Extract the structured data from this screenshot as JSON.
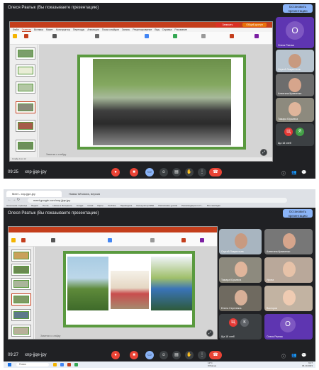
{
  "shot1": {
    "meet_title": "Олеся Рватык (Вы показываете презентацию)",
    "present_button": "Остановить презентацию",
    "time": "09:25",
    "meeting_code": "xnp-jjqe-jpy",
    "ppt_tabs": [
      "Файл",
      "Главная",
      "Вставка",
      "Макет",
      "Конструктор",
      "Переходы",
      "Анимация",
      "Показ слайдов",
      "Запись",
      "Рецензирование",
      "Вид",
      "Справка",
      "Рисование"
    ],
    "record_label": "Записать",
    "share_label": "Общий доступ",
    "notes_label": "Заметки к слайду",
    "status_text": "Слайд 4 из 12",
    "participants": [
      {
        "name": "Олеся Рватык",
        "initial": "О",
        "color": "#7e57c2"
      },
      {
        "name": "Сергей Лаврентьев"
      },
      {
        "name": "Алевтина Кравченко"
      },
      {
        "name": "Тамара Юрьевна"
      },
      {
        "name": "Ща 18 хлеб",
        "initials": [
          "Щ",
          "Я"
        ]
      }
    ]
  },
  "shot2": {
    "tabs": [
      {
        "label": "Meet - xnp-jjqe-jpy"
      },
      {
        "label": "Новая Windows, версия"
      }
    ],
    "url": "meet.google.com/xnp-jjqe-jpy",
    "bookmarks": [
      "Начальная страница",
      "Яндекс",
      "Почта",
      "Новые в Интернете",
      "Google",
      "Gmail",
      "Карты",
      "YouTube",
      "Переводчик",
      "Калькулятор ВАШ",
      "Расписание уроков",
      "Рекомендации по П...",
      "Все закладки"
    ],
    "meet_title": "Олеся Рватык (Вы показываете презентацию)",
    "present_button": "Остановить презентацию",
    "time": "09:27",
    "meeting_code": "xnp-jjqe-jpy",
    "notes_label": "Заметки к слайду",
    "participants": [
      {
        "name": "Сергей Лаврентьев"
      },
      {
        "name": "Алевтина Кравченко"
      },
      {
        "name": "Тамара Юрьевна"
      },
      {
        "name": "Ирина"
      },
      {
        "name": "Елена Сергеевна"
      },
      {
        "name": "Виктория"
      },
      {
        "name": "Ща 18 хлеб",
        "initials": [
          "Щ",
          "К"
        ]
      },
      {
        "name": "Олеся Рватык",
        "initial": "О"
      }
    ],
    "taskbar": {
      "search": "Поиск",
      "weather_temp": "12°C",
      "weather_desc": "Облачно",
      "clock_time": "9:27",
      "clock_date": "06.10.2023"
    }
  }
}
